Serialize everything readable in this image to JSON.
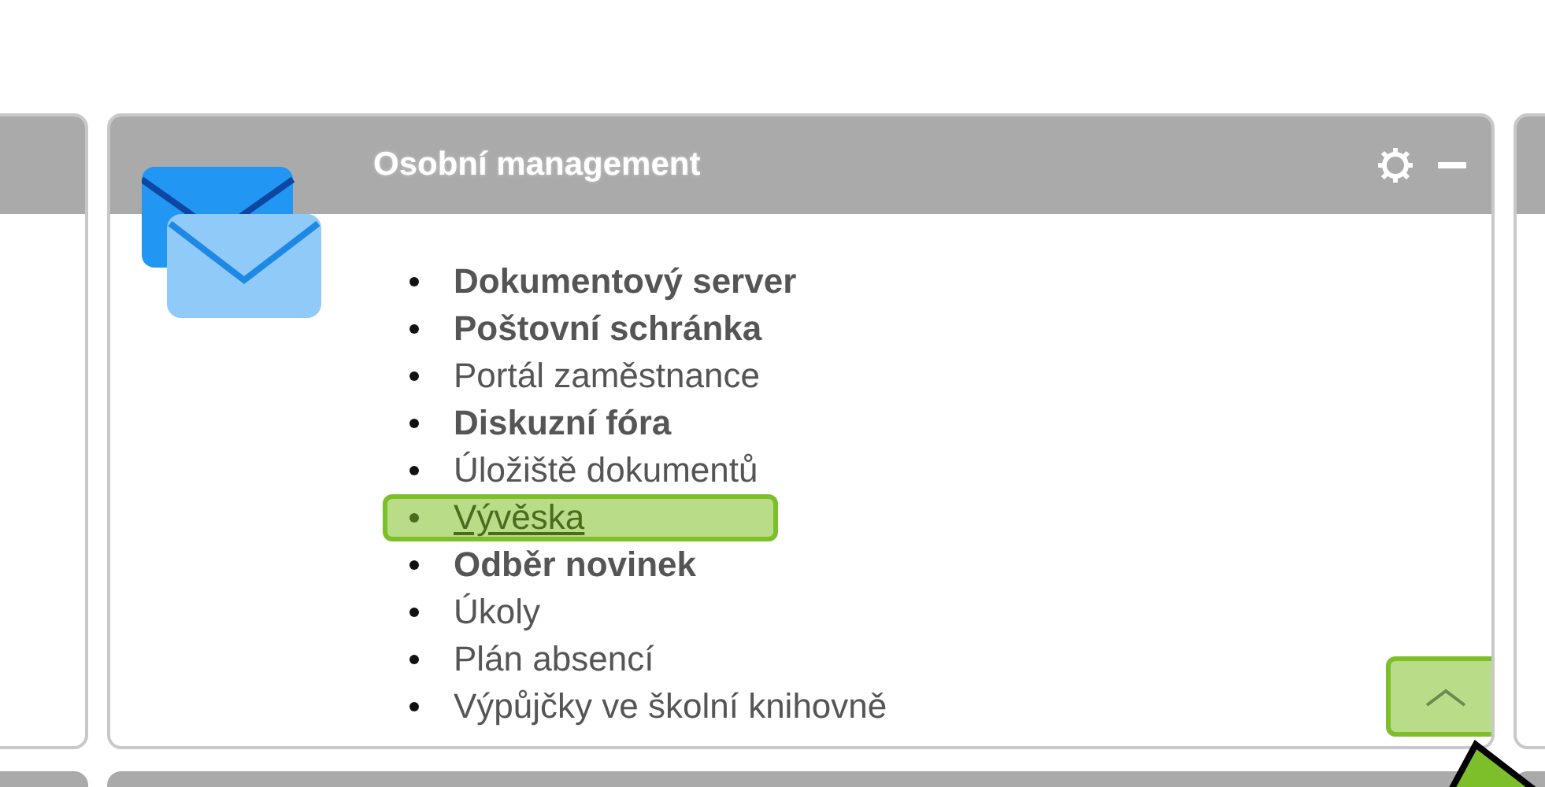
{
  "panel": {
    "title": "Osobní management",
    "items": [
      {
        "label": "Dokumentový server",
        "bold": true,
        "highlighted": false
      },
      {
        "label": "Poštovní schránka",
        "bold": true,
        "highlighted": false
      },
      {
        "label": "Portál zaměstnance",
        "bold": false,
        "highlighted": false
      },
      {
        "label": "Diskuzní fóra",
        "bold": true,
        "highlighted": false
      },
      {
        "label": "Úložiště dokumentů",
        "bold": false,
        "highlighted": false
      },
      {
        "label": "Vývěska",
        "bold": false,
        "highlighted": true
      },
      {
        "label": "Odběr novinek",
        "bold": true,
        "highlighted": false
      },
      {
        "label": "Úkoly",
        "bold": false,
        "highlighted": false
      },
      {
        "label": "Plán absencí",
        "bold": false,
        "highlighted": false
      },
      {
        "label": "Výpůjčky ve školní knihovně",
        "bold": false,
        "highlighted": false
      }
    ],
    "scroll_up_highlighted": true
  }
}
